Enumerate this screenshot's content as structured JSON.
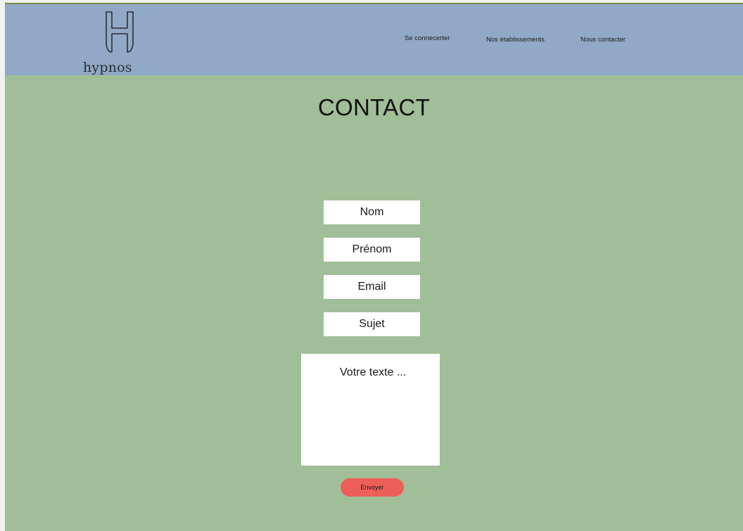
{
  "brand": {
    "logo_icon": "h-monogram-icon",
    "name": "hypnos"
  },
  "nav": {
    "login_label": "Se connecerter",
    "hotels_label": "Nos établissements",
    "contact_label": "Nous contacter"
  },
  "page": {
    "title": "CONTACT"
  },
  "form": {
    "last_name_placeholder": "Nom",
    "first_name_placeholder": "Prénom",
    "email_placeholder": "Email",
    "subject_placeholder": "Sujet",
    "message_placeholder": "Votre texte ...",
    "submit_label": "Envoyer"
  },
  "colors": {
    "header_bg": "#91a9c6",
    "page_bg": "#a0be98",
    "button_bg": "#ee5e58"
  }
}
